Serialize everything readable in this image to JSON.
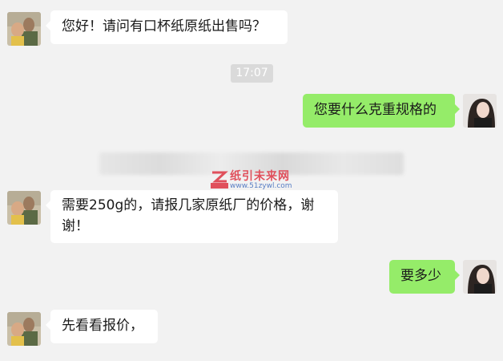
{
  "messages": [
    {
      "side": "left",
      "text": "您好！请问有口杯纸原纸出售吗？"
    },
    {
      "side": "right",
      "text": "您要什么克重规格的"
    },
    {
      "side": "left",
      "text_line1": "需要250g的，请报几家原纸厂的价格，谢",
      "text_line2": "谢！"
    },
    {
      "side": "right",
      "text": "要多少"
    },
    {
      "side": "left",
      "text": "先看看报价，"
    }
  ],
  "timestamp": "17:07",
  "watermark": {
    "name": "纸引未来网",
    "url": "www.51zywl.com",
    "badge": "纸引未来"
  },
  "colors": {
    "background": "#f2f2f2",
    "sent_bubble": "#95ec69",
    "received_bubble": "#ffffff",
    "timestamp_bg": "#dadada"
  }
}
